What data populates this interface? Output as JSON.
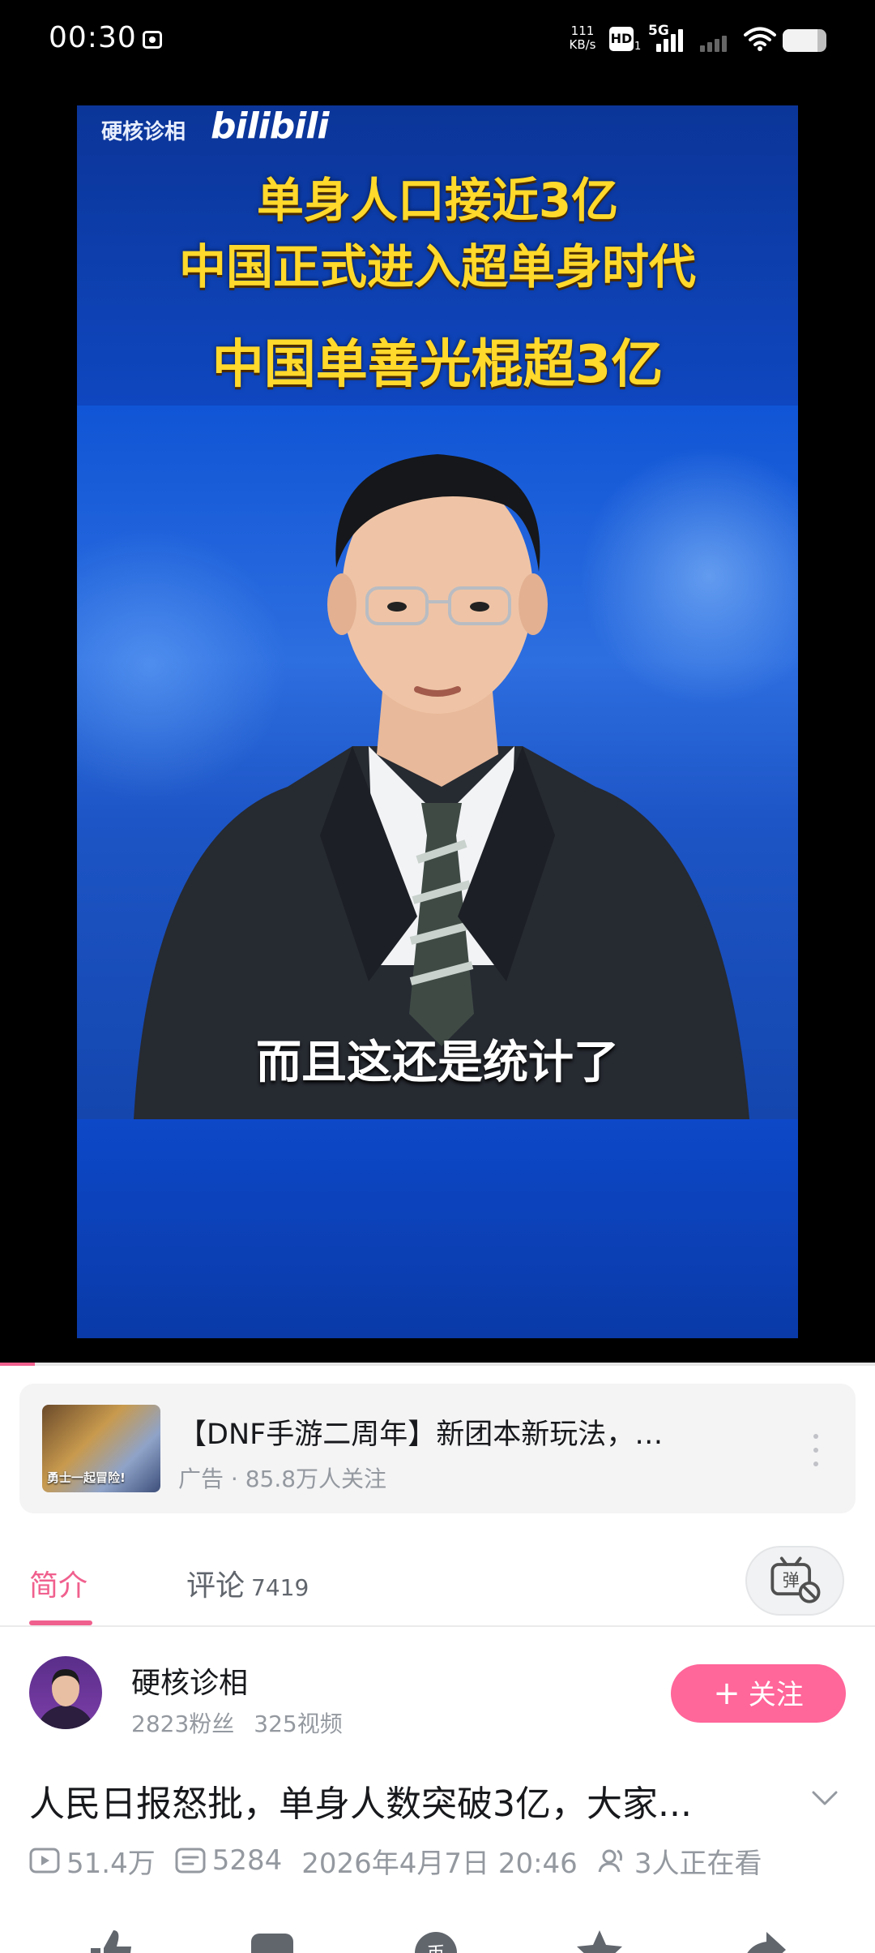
{
  "status_bar": {
    "time": "00:30",
    "net_speed_value": "111",
    "net_speed_unit": "KB/s",
    "hd_label": "HD",
    "hd_sub": "1",
    "network_type": "5G",
    "battery_percent": 80
  },
  "video": {
    "channel_name": "硬核诊相",
    "brand": "bilibili",
    "headline_1": "单身人口接近3亿",
    "headline_2": "中国正式进入超单身时代",
    "headline_3": "中国单善光棍超3亿",
    "caption": "而且这还是统计了",
    "progress": 0.04
  },
  "ad": {
    "thumb_text": "勇士一起冒险!",
    "title": "【DNF手游二周年】新团本新玩法，…",
    "meta": "广告 · 85.8万人关注"
  },
  "tabs": {
    "intro_label": "简介",
    "comments_label": "评论",
    "comments_count": "7419",
    "danmaku_icon": "danmaku-off-icon"
  },
  "uploader": {
    "name": "硬核诊相",
    "fans": "2823粉丝",
    "videos": "325视频",
    "follow_label": "关注"
  },
  "video_info": {
    "title": "人民日报怒批，单身人数突破3亿，大家...",
    "views": "51.4万",
    "danmaku": "5284",
    "date": "2026年4月7日 20:46",
    "watching": "3人正在看"
  },
  "colors": {
    "accent": "#ff6699",
    "tab_active": "#f0608e",
    "text_primary": "#18191c",
    "text_secondary": "#9499a0"
  }
}
